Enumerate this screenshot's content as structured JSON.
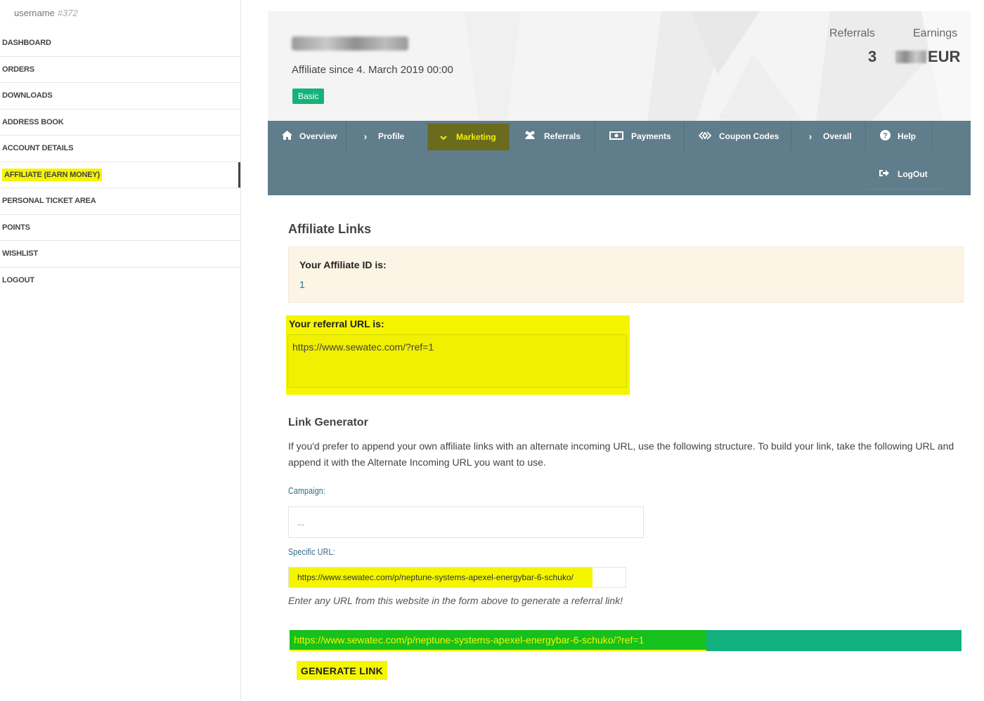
{
  "user": {
    "name": "username",
    "id": "#372"
  },
  "sidebar": {
    "items": [
      {
        "label": "DASHBOARD"
      },
      {
        "label": "ORDERS"
      },
      {
        "label": "DOWNLOADS"
      },
      {
        "label": "ADDRESS BOOK"
      },
      {
        "label": "ACCOUNT DETAILS"
      },
      {
        "label": "AFFILIATE (EARN MONEY)",
        "active": true
      },
      {
        "label": "PERSONAL TICKET AREA"
      },
      {
        "label": "POINTS"
      },
      {
        "label": "WISHLIST"
      },
      {
        "label": "LOGOUT"
      }
    ]
  },
  "header": {
    "since": "Affiliate since 4. March 2019 00:00",
    "badge": "Basic",
    "referrals_label": "Referrals",
    "referrals_value": "3",
    "earnings_label": "Earnings",
    "earnings_currency": "EUR"
  },
  "nav": {
    "items": [
      {
        "label": "Overview",
        "icon": "home-icon"
      },
      {
        "label": "Profile",
        "icon": "chevron-right-icon"
      },
      {
        "label": "Marketing",
        "icon": "chevron-down-icon",
        "active": true
      },
      {
        "label": "Referrals",
        "icon": "users-icon"
      },
      {
        "label": "Payments",
        "icon": "money-icon"
      },
      {
        "label": "Coupon Codes",
        "icon": "code-icon"
      },
      {
        "label": "Overall",
        "icon": "chevron-right-icon"
      },
      {
        "label": "Help",
        "icon": "question-circle-icon"
      }
    ],
    "logout": "LogOut"
  },
  "content": {
    "title": "Affiliate Links",
    "id_label": "Your Affiliate ID is:",
    "id_value": "1",
    "ref_label": "Your referral URL is:",
    "ref_url": "https://www.sewatec.com/?ref=1",
    "gen_title": "Link Generator",
    "gen_desc": "If you'd prefer to append your own affiliate links with an alternate incoming URL, use the following structure. To build your link, take the following URL and append it with the Alternate Incoming URL you want to use.",
    "campaign_label": "Campaign:",
    "campaign_placeholder": "...",
    "specific_label": "Specific URL:",
    "specific_value": "https://www.sewatec.com/p/neptune-systems-apexel-energybar-6-schuko/",
    "hint": "Enter any URL from this website in the form above to generate a referral link!",
    "result": "https://www.sewatec.com/p/neptune-systems-apexel-energybar-6-schuko/?ref=1",
    "button": "GENERATE LINK"
  },
  "colors": {
    "accent": "#15b37a",
    "nav": "#607d8b",
    "highlight": "#f5f500"
  }
}
